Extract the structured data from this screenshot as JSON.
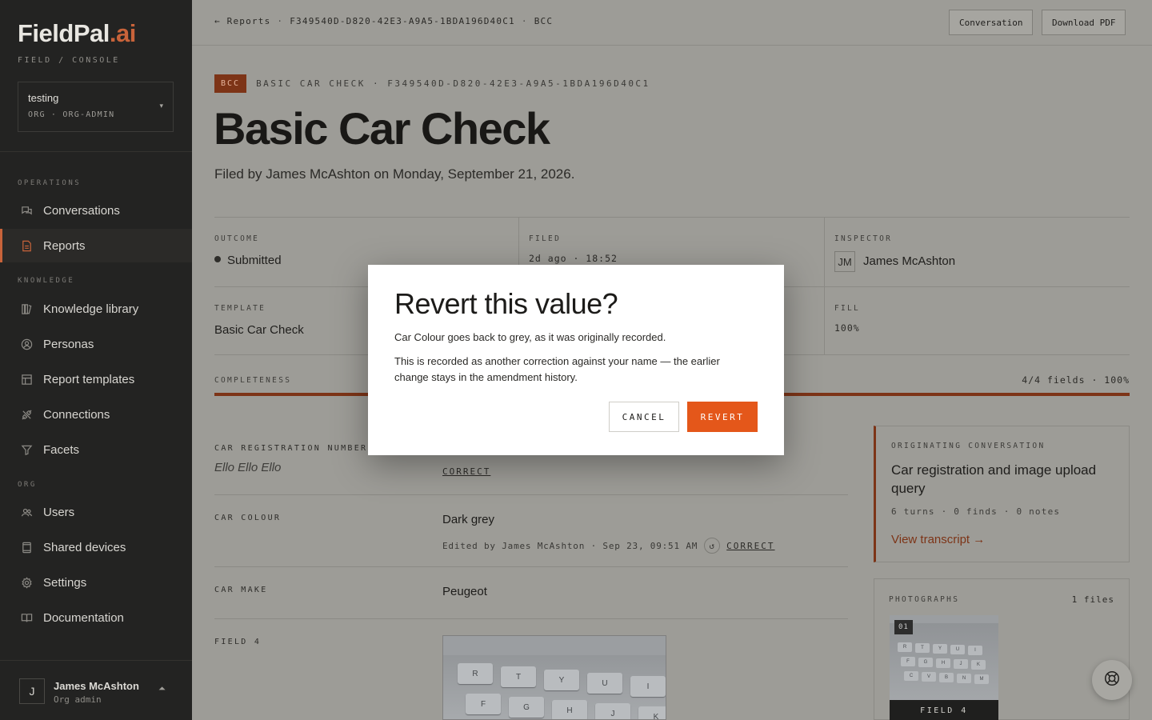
{
  "brand": {
    "name_main": "FieldPal",
    "name_suffix": ".ai",
    "subtitle": "FIELD / CONSOLE"
  },
  "org": {
    "name": "testing",
    "meta": "ORG · ORG-ADMIN"
  },
  "sidebar": {
    "sections": {
      "operations": "OPERATIONS",
      "knowledge": "KNOWLEDGE",
      "org": "ORG"
    },
    "items": [
      {
        "label": "Conversations",
        "icon": "chat-bubbles-icon"
      },
      {
        "label": "Reports",
        "icon": "document-icon",
        "active": true
      },
      {
        "label": "Knowledge library",
        "icon": "books-icon"
      },
      {
        "label": "Personas",
        "icon": "persona-icon"
      },
      {
        "label": "Report templates",
        "icon": "template-icon"
      },
      {
        "label": "Connections",
        "icon": "plug-icon"
      },
      {
        "label": "Facets",
        "icon": "filter-icon"
      },
      {
        "label": "Users",
        "icon": "users-icon"
      },
      {
        "label": "Shared devices",
        "icon": "tablet-icon"
      },
      {
        "label": "Settings",
        "icon": "gear-icon"
      },
      {
        "label": "Documentation",
        "icon": "book-open-icon"
      }
    ]
  },
  "user": {
    "initial": "J",
    "name": "James McAshton",
    "role": "Org admin"
  },
  "topbar": {
    "back": "← Reports",
    "report_id": "F349540D-D820-42E3-A9A5-1BDA196D40C1",
    "code": "BCC",
    "conversation_btn": "Conversation",
    "download_btn": "Download PDF"
  },
  "report": {
    "tag": "BCC",
    "tagline": "BASIC CAR CHECK · F349540D-D820-42E3-A9A5-1BDA196D40C1",
    "title": "Basic Car Check",
    "subtitle": "Filed by James McAshton on Monday, September 21, 2026."
  },
  "summary": {
    "outcome_label": "OUTCOME",
    "outcome_value": "Submitted",
    "filed_label": "FILED",
    "filed_value": "2d ago · 18:52",
    "inspector_label": "INSPECTOR",
    "inspector_initials": "JM",
    "inspector_name": "James McAshton",
    "template_label": "TEMPLATE",
    "template_value": "Basic Car Check",
    "fill_label": "FILL",
    "fill_value": "100%",
    "completeness_label": "COMPLETENESS",
    "completeness_value": "4/4 fields · 100%",
    "completeness_pct": 100
  },
  "fields": {
    "reg_label": "CAR REGISTRATION NUMBER",
    "reg_value": "Ello Ello Ello",
    "reg_action": "CORRECT",
    "colour_label": "CAR COLOUR",
    "colour_value": "Dark grey",
    "colour_edited": "Edited by James McAshton · Sep 23, 09:51 AM",
    "colour_action": "CORRECT",
    "make_label": "CAR MAKE",
    "make_value": "Peugeot",
    "field4_label": "FIELD 4"
  },
  "originating": {
    "label": "ORIGINATING CONVERSATION",
    "title": "Car registration and image upload query",
    "meta": "6 turns · 0 finds · 0 notes",
    "link": "View transcript →"
  },
  "photos": {
    "label": "PHOTOGRAPHS",
    "count": "1 files",
    "thumb_num": "01",
    "thumb_caption": "FIELD 4",
    "keys": [
      "R",
      "T",
      "Y",
      "U",
      "I",
      "F",
      "G",
      "H",
      "J",
      "K"
    ],
    "mini_keys": [
      "R",
      "T",
      "Y",
      "U",
      "I",
      "F",
      "G",
      "H",
      "J",
      "K",
      "C",
      "V",
      "B",
      "N",
      "M"
    ]
  },
  "modal": {
    "title": "Revert this value?",
    "p1": "Car Colour goes back to grey, as it was originally recorded.",
    "p2": "This is recorded as another correction against your name — the earlier change stays in the amendment history.",
    "cancel": "CANCEL",
    "revert": "REVERT"
  },
  "colors": {
    "accent": "#e4571a",
    "accent_dark": "#7d3417",
    "sidebar_bg": "#232322"
  }
}
